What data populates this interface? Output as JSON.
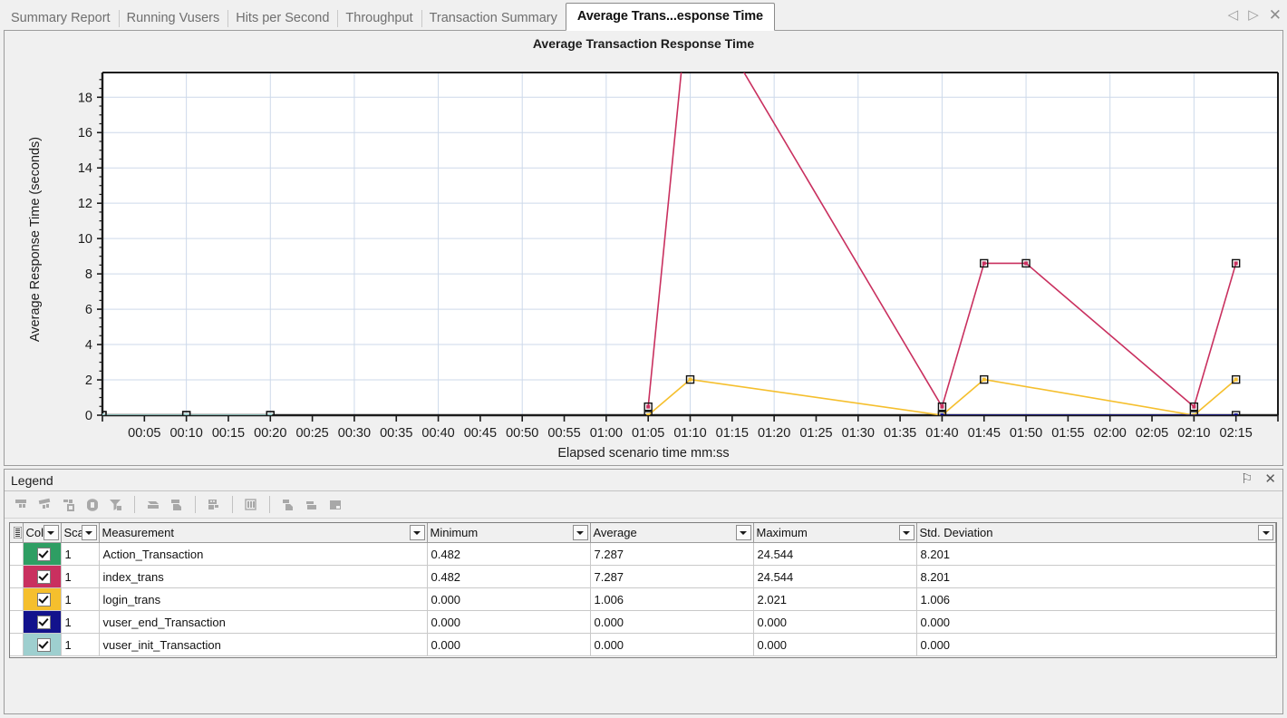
{
  "tabs": [
    {
      "label": "Summary Report",
      "active": false
    },
    {
      "label": "Running Vusers",
      "active": false
    },
    {
      "label": "Hits per Second",
      "active": false
    },
    {
      "label": "Throughput",
      "active": false
    },
    {
      "label": "Transaction Summary",
      "active": false
    },
    {
      "label": "Average Trans...esponse Time",
      "active": true
    }
  ],
  "tabnav": {
    "prev": "◁",
    "next": "▷",
    "close": "✕"
  },
  "graph": {
    "title": "Average Transaction Response Time",
    "ylabel": "Average Response Time (seconds)",
    "xlabel": "Elapsed scenario time mm:ss"
  },
  "legend_panel": {
    "title": "Legend",
    "pin": "⚐",
    "close": "✕",
    "toolbar_icons": [
      "filter-graph-icon",
      "clear-filter-icon",
      "group-by-icon",
      "drill-down-icon",
      "auto-filter-icon",
      "merge-graphs-icon",
      "overlay-graph-icon",
      "set-granularity-icon",
      "show-columns-icon",
      "add-measurement-icon",
      "remove-measurement-icon",
      "export-icon"
    ]
  },
  "table": {
    "columns": [
      "Col",
      "Sca",
      "Measurement",
      "Minimum",
      "Average",
      "Maximum",
      "Std. Deviation"
    ],
    "rows": [
      {
        "color": "#2e9e63",
        "checked": true,
        "scale": "1",
        "measurement": "Action_Transaction",
        "minimum": "0.482",
        "average": "7.287",
        "maximum": "24.544",
        "stddev": "8.201"
      },
      {
        "color": "#c9305f",
        "checked": true,
        "scale": "1",
        "measurement": "index_trans",
        "minimum": "0.482",
        "average": "7.287",
        "maximum": "24.544",
        "stddev": "8.201"
      },
      {
        "color": "#f5bf2d",
        "checked": true,
        "scale": "1",
        "measurement": "login_trans",
        "minimum": "0.000",
        "average": "1.006",
        "maximum": "2.021",
        "stddev": "1.006"
      },
      {
        "color": "#12128c",
        "checked": true,
        "scale": "1",
        "measurement": "vuser_end_Transaction",
        "minimum": "0.000",
        "average": "0.000",
        "maximum": "0.000",
        "stddev": "0.000"
      },
      {
        "color": "#9ecfcf",
        "checked": true,
        "scale": "1",
        "measurement": "vuser_init_Transaction",
        "minimum": "0.000",
        "average": "0.000",
        "maximum": "0.000",
        "stddev": "0.000"
      }
    ]
  },
  "chart_data": {
    "type": "line",
    "title": "Average Transaction Response Time",
    "xlabel": "Elapsed scenario time mm:ss",
    "ylabel": "Average Response Time (seconds)",
    "grid": true,
    "legend_position": "bottom-table",
    "xlim": [
      0,
      140
    ],
    "ylim": [
      0,
      19.4
    ],
    "yticks": [
      0,
      2,
      4,
      6,
      8,
      10,
      12,
      14,
      16,
      18
    ],
    "xticks": [
      "00:00",
      "00:05",
      "00:10",
      "00:15",
      "00:20",
      "00:25",
      "00:30",
      "00:35",
      "00:40",
      "00:45",
      "00:50",
      "00:55",
      "01:00",
      "01:05",
      "01:10",
      "01:15",
      "01:20",
      "01:25",
      "01:30",
      "01:35",
      "01:40",
      "01:45",
      "01:50",
      "01:55",
      "02:00",
      "02:05",
      "02:10",
      "02:15"
    ],
    "xtick_labels": [
      "00:05",
      "00:10",
      "00:15",
      "00:20",
      "00:25",
      "00:30",
      "00:35",
      "00:40",
      "00:45",
      "00:50",
      "00:55",
      "01:00",
      "01:05",
      "01:10",
      "01:15",
      "01:20",
      "01:25",
      "01:30",
      "01:35",
      "01:40",
      "01:45",
      "01:50",
      "01:55",
      "02:00",
      "02:05",
      "02:10",
      "02:15"
    ],
    "series": [
      {
        "name": "Action_Transaction",
        "color": "#2e9e63",
        "x": [
          0,
          10,
          20
        ],
        "y": [
          0,
          0,
          0
        ]
      },
      {
        "name": "index_trans",
        "color": "#c9305f",
        "x": [
          65,
          70,
          100,
          105,
          110,
          130,
          135
        ],
        "y": [
          0.48,
          24.544,
          0.48,
          8.6,
          8.6,
          0.48,
          8.6
        ],
        "note": "peak at 01:10 clipped above axis top"
      },
      {
        "name": "login_trans",
        "color": "#f5bf2d",
        "x": [
          65,
          70,
          100,
          105,
          130,
          135
        ],
        "y": [
          0.0,
          2.021,
          0.0,
          2.021,
          0.0,
          2.021
        ]
      },
      {
        "name": "vuser_end_Transaction",
        "color": "#12128c",
        "x": [
          100,
          135
        ],
        "y": [
          0,
          0
        ]
      },
      {
        "name": "vuser_init_Transaction",
        "color": "#9ecfcf",
        "x": [
          0,
          10,
          20
        ],
        "y": [
          0,
          0,
          0
        ]
      }
    ]
  }
}
